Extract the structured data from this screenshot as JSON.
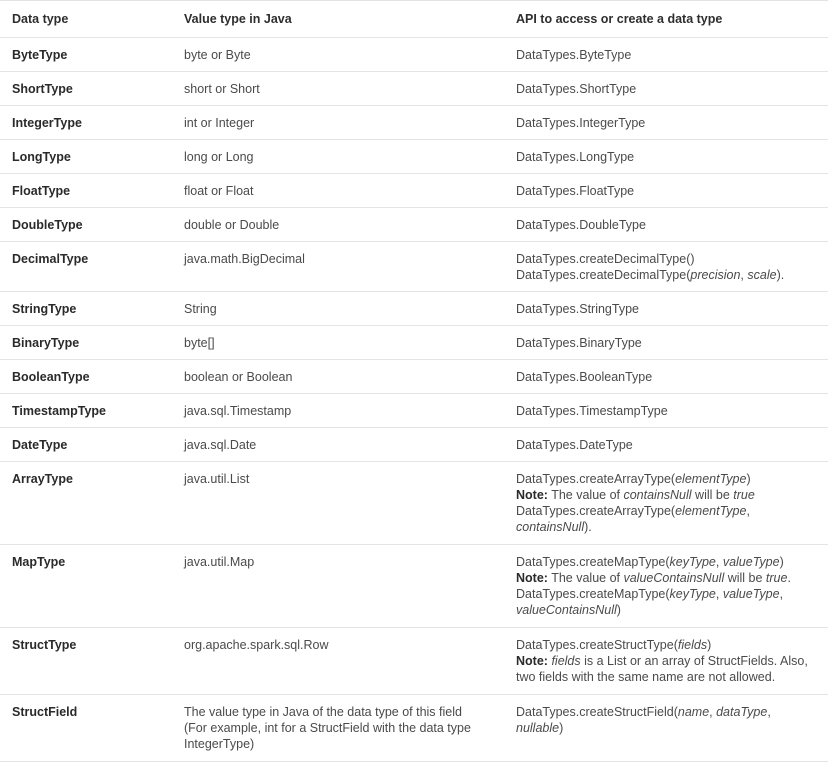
{
  "table": {
    "columns": [
      {
        "key": "name",
        "label": "Data type"
      },
      {
        "key": "java",
        "label": "Value type in Java"
      },
      {
        "key": "api",
        "label": "API to access or create a data type"
      }
    ],
    "rows": [
      {
        "name": "ByteType",
        "java": [
          "byte or Byte"
        ],
        "api": [
          {
            "text": "DataTypes.ByteType"
          }
        ]
      },
      {
        "name": "ShortType",
        "java": [
          "short or Short"
        ],
        "api": [
          {
            "text": "DataTypes.ShortType"
          }
        ]
      },
      {
        "name": "IntegerType",
        "java": [
          "int or Integer"
        ],
        "api": [
          {
            "text": "DataTypes.IntegerType"
          }
        ]
      },
      {
        "name": "LongType",
        "java": [
          "long or Long"
        ],
        "api": [
          {
            "text": "DataTypes.LongType"
          }
        ]
      },
      {
        "name": "FloatType",
        "java": [
          "float or Float"
        ],
        "api": [
          {
            "text": "DataTypes.FloatType"
          }
        ]
      },
      {
        "name": "DoubleType",
        "java": [
          "double or Double"
        ],
        "api": [
          {
            "text": "DataTypes.DoubleType"
          }
        ]
      },
      {
        "name": "DecimalType",
        "java": [
          "java.math.BigDecimal"
        ],
        "api": [
          {
            "text": "DataTypes.createDecimalType()"
          },
          {
            "html": "DataTypes.createDecimalType(<em class=\"param\">precision</em>, <em class=\"param\">scale</em>)."
          }
        ]
      },
      {
        "name": "StringType",
        "java": [
          "String"
        ],
        "api": [
          {
            "text": "DataTypes.StringType"
          }
        ]
      },
      {
        "name": "BinaryType",
        "java": [
          "byte[]"
        ],
        "api": [
          {
            "text": "DataTypes.BinaryType"
          }
        ]
      },
      {
        "name": "BooleanType",
        "java": [
          "boolean or Boolean"
        ],
        "api": [
          {
            "text": "DataTypes.BooleanType"
          }
        ]
      },
      {
        "name": "TimestampType",
        "java": [
          "java.sql.Timestamp"
        ],
        "api": [
          {
            "text": "DataTypes.TimestampType"
          }
        ]
      },
      {
        "name": "DateType",
        "java": [
          "java.sql.Date"
        ],
        "api": [
          {
            "text": "DataTypes.DateType"
          }
        ]
      },
      {
        "name": "ArrayType",
        "java": [
          "java.util.List"
        ],
        "api": [
          {
            "html": "DataTypes.createArrayType(<em class=\"param\">elementType</em>)"
          },
          {
            "html": "<span class=\"note-label\">Note:</span> The value of <em class=\"param\">containsNull</em> will be <em class=\"param\">true</em>"
          },
          {
            "html": "DataTypes.createArrayType(<em class=\"param\">elementType</em>,"
          },
          {
            "html": "<em class=\"param\">containsNull</em>)."
          }
        ]
      },
      {
        "name": "MapType",
        "java": [
          "java.util.Map"
        ],
        "api": [
          {
            "html": "DataTypes.createMapType(<em class=\"param\">keyType</em>, <em class=\"param\">valueType</em>)"
          },
          {
            "html": "<span class=\"note-label\">Note:</span> The value of <em class=\"param\">valueContainsNull</em> will be <em class=\"param\">true</em>."
          },
          {
            "html": "DataTypes.createMapType(<em class=\"param\">keyType</em>, <em class=\"param\">valueType</em>,"
          },
          {
            "html": "<em class=\"param\">valueContainsNull</em>)"
          }
        ]
      },
      {
        "name": "StructType",
        "java": [
          "org.apache.spark.sql.Row"
        ],
        "api": [
          {
            "html": "DataTypes.createStructType(<em class=\"param\">fields</em>)"
          },
          {
            "html": "<span class=\"note-label\">Note:</span> <em class=\"param\">fields</em> is a List or an array of StructFields. Also,"
          },
          {
            "html": "two fields with the same name are not allowed."
          }
        ]
      },
      {
        "name": "StructField",
        "java": [
          "The value type in Java of the data type of this field",
          "(For example, int for a StructField with the data type",
          "IntegerType)"
        ],
        "api": [
          {
            "html": "DataTypes.createStructField(<em class=\"param\">name</em>, <em class=\"param\">dataType</em>, <em class=\"param\">nullable</em>)"
          }
        ]
      }
    ]
  },
  "style": {
    "border_color": "#e4e4e4",
    "header_text_color": "#2e2e2e",
    "body_text_color": "#4a4a4a",
    "background": "#ffffff"
  }
}
